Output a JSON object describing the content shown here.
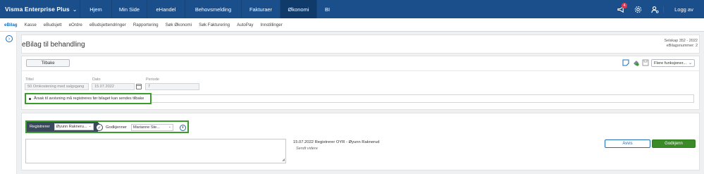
{
  "topbar": {
    "brand": "Visma Enterprise Plus",
    "brand_caret": "⌄",
    "nav": [
      "Hjem",
      "Min Side",
      "eHandel",
      "Behovsmelding",
      "Fakturaer",
      "Økonomi",
      "BI"
    ],
    "active_nav": "Økonomi",
    "notification_count": "4",
    "logout_label": "Logg av"
  },
  "subnav": {
    "items": [
      "eBilag",
      "Kasse",
      "eBudsjett",
      "eOrdre",
      "eBudsjettendringer",
      "Rapportering",
      "Søk Økonomi",
      "Søk Fakturering",
      "AutoPay",
      "Innstillinger"
    ],
    "active": "eBilag"
  },
  "header": {
    "title": "eBilag til behandling",
    "company": "Selskap 352 - 2022",
    "voucher_number": "eBilagsnummer: 2"
  },
  "toolbar": {
    "back_label": "Tilbake",
    "functions_label": "Flere funksjoner..."
  },
  "form": {
    "title_label": "Tittel",
    "title_value": "50 Omkostening med salgsgang",
    "date_label": "Dato",
    "date_value": "15.07.2022",
    "period_label": "Periode",
    "period_value": "7"
  },
  "validation": {
    "message": "Årsak til avvisning må registreres før bilaget kan sendes tilbake"
  },
  "workflow": {
    "register_label": "Registrerer",
    "register_user": "Øyunn Rakneru...",
    "approve_label": "Godkjenner",
    "approve_user": "Marianne Ste..."
  },
  "log": {
    "entry": "15.07.2022 Registrerer OYR - Øyunn Raknerud",
    "status": "Sendt videre"
  },
  "actions": {
    "reject_label": "Avvis",
    "approve_label": "Godkjenn"
  },
  "colors": {
    "topbar": "#1b4f8c",
    "highlight": "#3a9c2a",
    "approve": "#3a8a28",
    "link": "#1b6cb5"
  }
}
